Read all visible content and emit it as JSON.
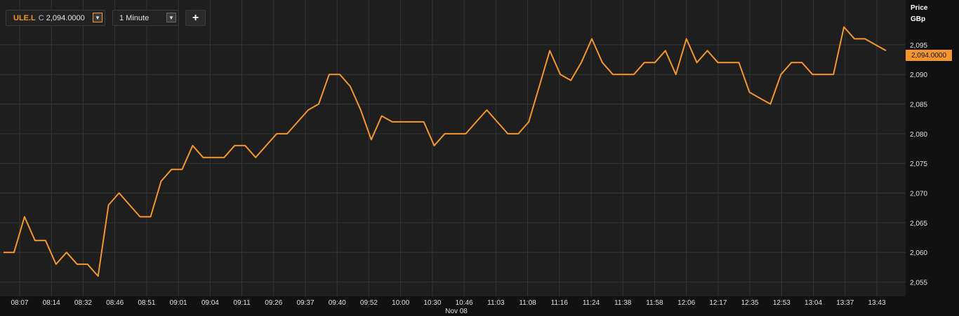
{
  "toolbar": {
    "symbol": "ULE.L",
    "close_label": "C",
    "close_value": "2,094.0000",
    "symbol_dropdown_glyph": "▼",
    "interval": "1 Minute",
    "interval_dropdown_glyph": "▼",
    "add_glyph": "+"
  },
  "axis": {
    "title": "Price",
    "unit": "GBp",
    "last_price_badge": "2,094.0000",
    "date_label": "Nov 08"
  },
  "colors": {
    "line": "#f7962d",
    "plot_background": "#1e1e1e",
    "grid": "#353535",
    "axis_text": "#e0e0e0"
  },
  "chart_data": {
    "type": "line",
    "title": "",
    "xlabel": "Nov 08",
    "ylabel": "Price GBp",
    "ylim": [
      2054,
      2099
    ],
    "grid": true,
    "y_ticks": [
      2055,
      2060,
      2065,
      2070,
      2075,
      2080,
      2085,
      2090,
      2095
    ],
    "y_tick_labels": [
      "2,055",
      "2,060",
      "2,065",
      "2,070",
      "2,075",
      "2,080",
      "2,085",
      "2,090",
      "2,095"
    ],
    "x_tick_labels": [
      "08:07",
      "08:14",
      "08:32",
      "08:46",
      "08:51",
      "09:01",
      "09:04",
      "09:11",
      "09:26",
      "09:37",
      "09:40",
      "09:52",
      "10:00",
      "10:30",
      "10:46",
      "11:03",
      "11:08",
      "11:16",
      "11:24",
      "11:38",
      "11:58",
      "12:06",
      "12:17",
      "12:35",
      "12:53",
      "13:04",
      "13:37",
      "13:43"
    ],
    "series": [
      {
        "values": [
          2060,
          2060,
          2066,
          2062,
          2062,
          2058,
          2060,
          2058,
          2058,
          2056,
          2068,
          2070,
          2068,
          2066,
          2066,
          2072,
          2074,
          2074,
          2078,
          2076,
          2076,
          2076,
          2078,
          2078,
          2076,
          2078,
          2080,
          2080,
          2082,
          2084,
          2085,
          2090,
          2090,
          2088,
          2084,
          2079,
          2083,
          2082,
          2082,
          2082,
          2082,
          2078,
          2080,
          2080,
          2080,
          2082,
          2084,
          2082,
          2080,
          2080,
          2082,
          2088,
          2094,
          2090,
          2089,
          2092,
          2096,
          2092,
          2090,
          2090,
          2090,
          2092,
          2092,
          2094,
          2090,
          2096,
          2092,
          2094,
          2092,
          2092,
          2092,
          2087,
          2086,
          2085,
          2090,
          2092,
          2092,
          2090,
          2090,
          2090,
          2098,
          2096,
          2096,
          2095,
          2094
        ]
      }
    ]
  }
}
